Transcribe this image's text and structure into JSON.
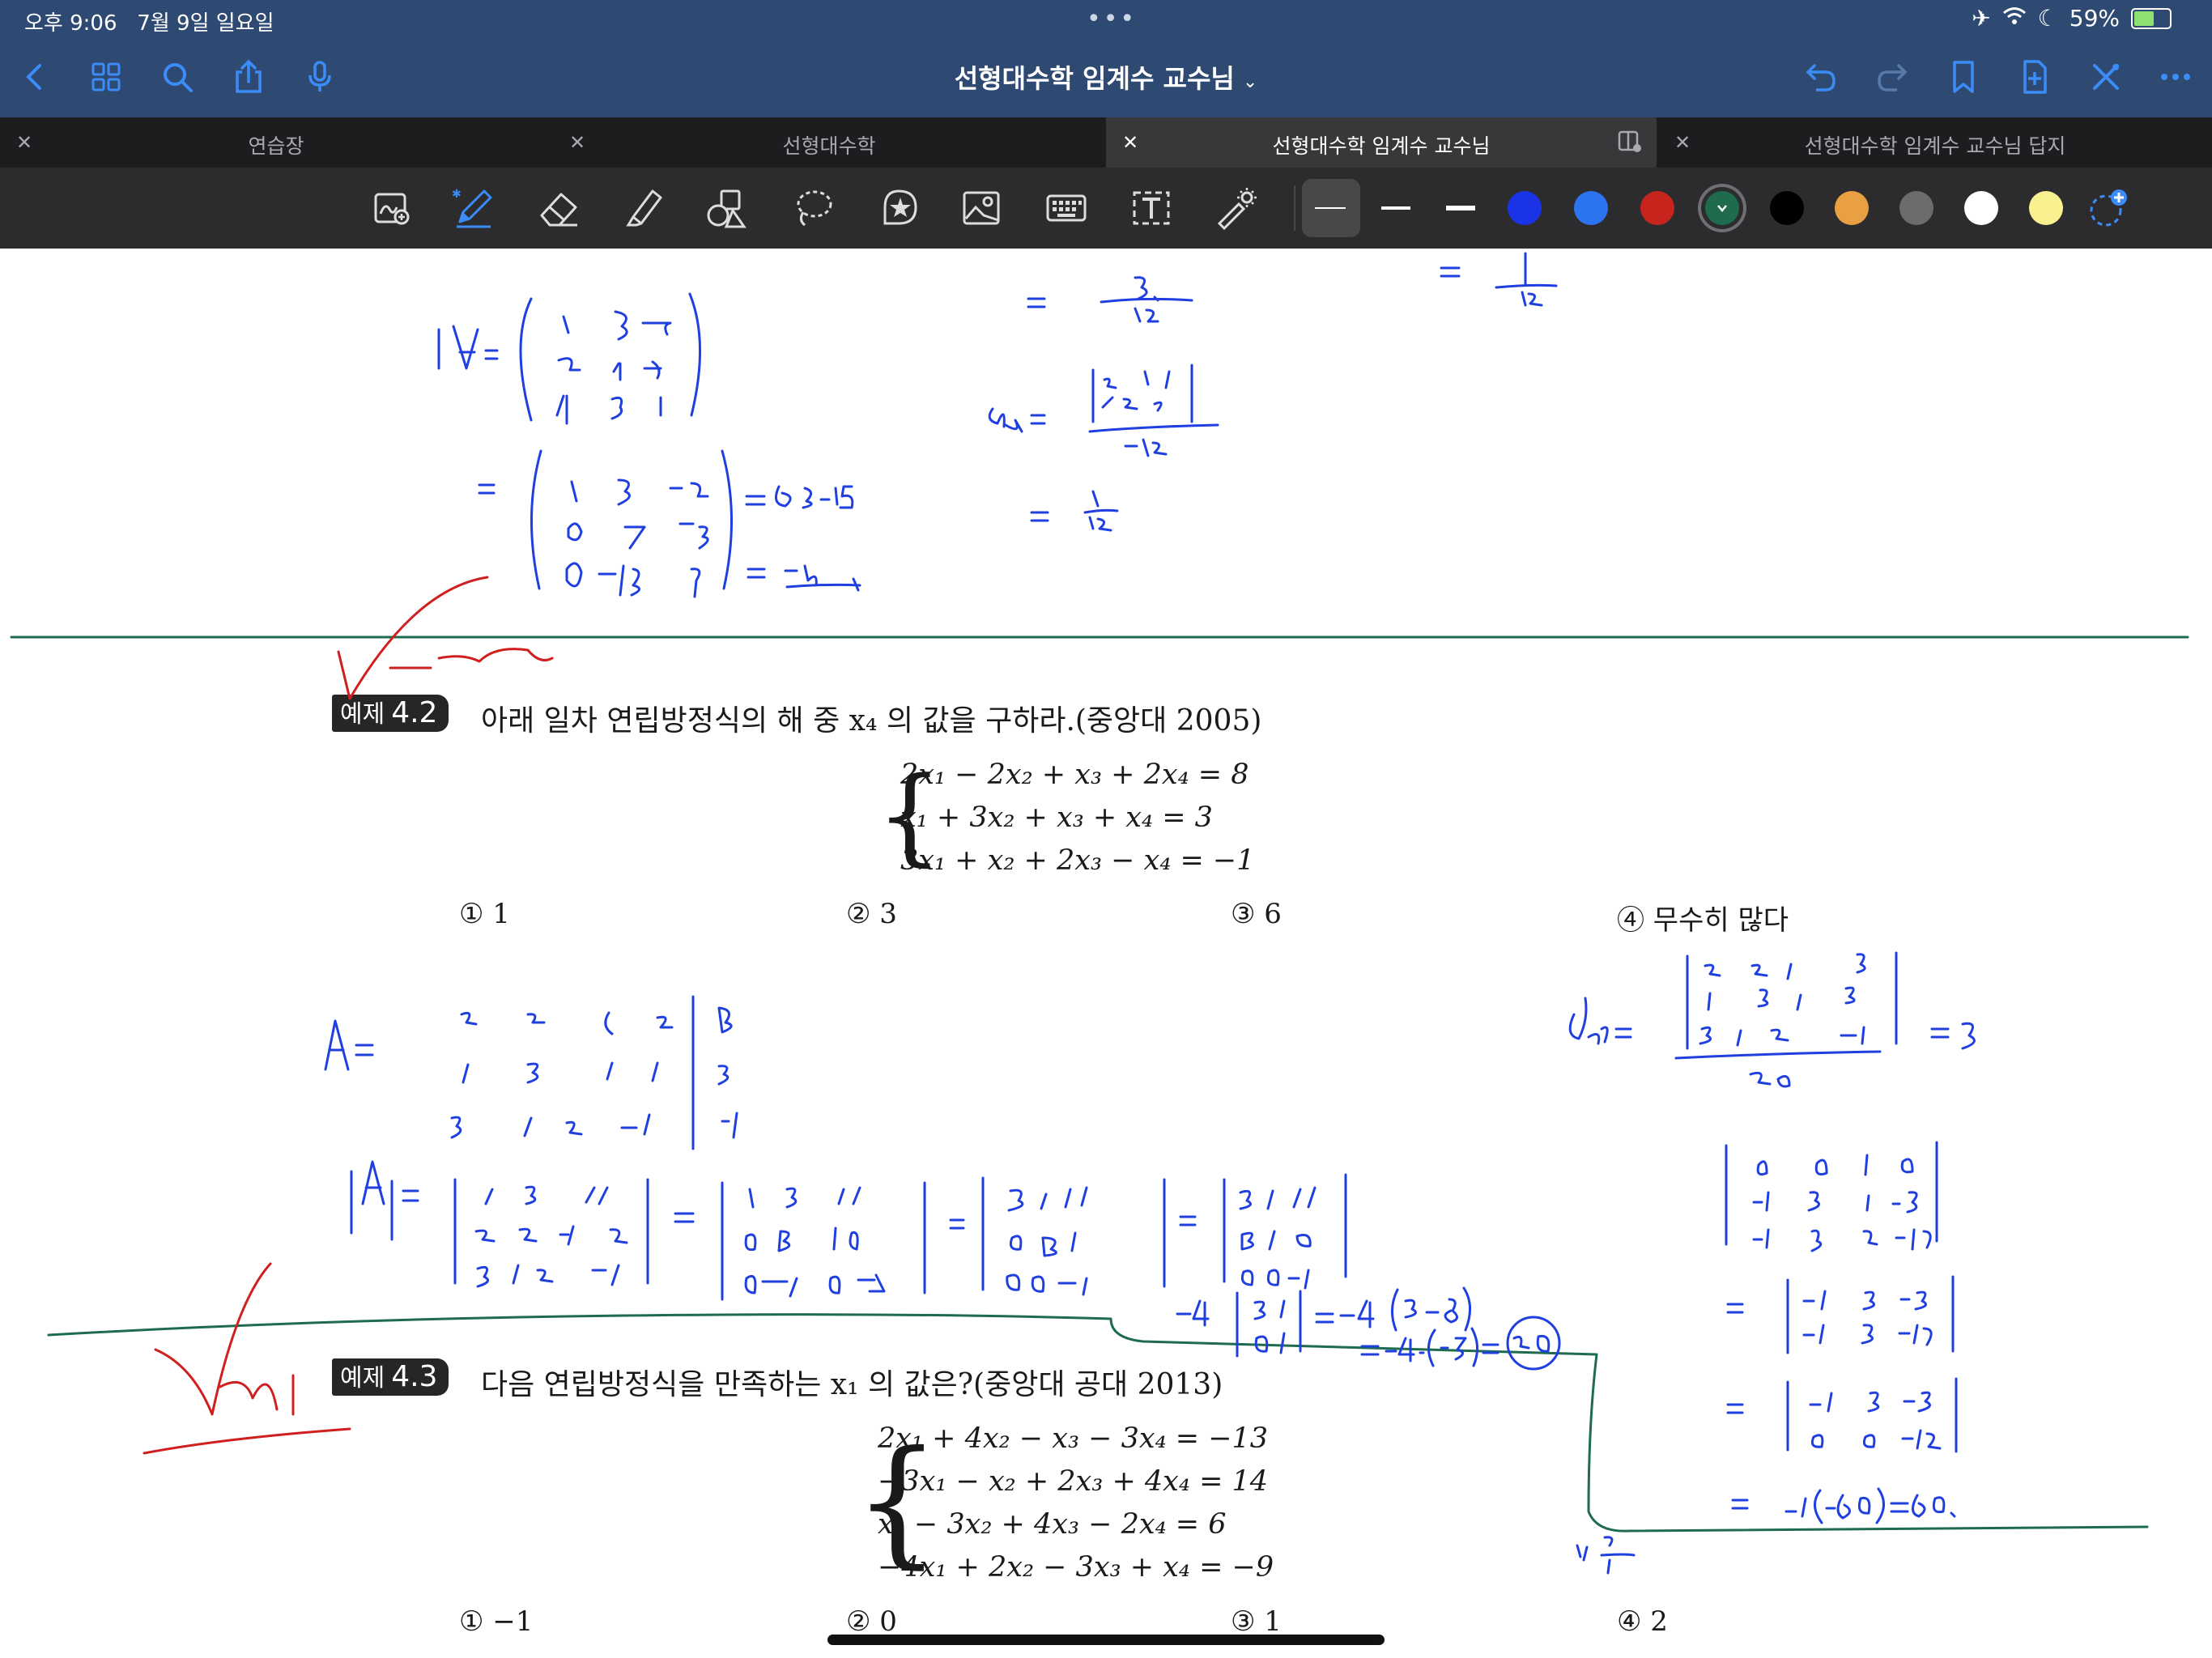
{
  "status_bar": {
    "time": "오후 9:06",
    "date": "7월 9일 일요일",
    "battery": "59%",
    "battery_level": 0.59
  },
  "nav": {
    "title": "선형대수학 임계수 교수님",
    "icons": [
      "back-icon",
      "grid-icon",
      "search-icon",
      "share-icon",
      "microphone-icon",
      "undo-icon",
      "redo-icon",
      "bookmark-icon",
      "add-page-icon",
      "close-x-icon",
      "more-icon"
    ]
  },
  "tabs": [
    {
      "label": "연습장",
      "active": false
    },
    {
      "label": "선형대수학",
      "active": false
    },
    {
      "label": "선형대수학 임계수 교수님",
      "active": true
    },
    {
      "label": "선형대수학 임계수 교수님 답지",
      "active": false
    }
  ],
  "toolbar": {
    "tools": [
      "lasso-search-icon",
      "pen-icon",
      "eraser-icon",
      "highlighter-icon",
      "shapes-icon",
      "lasso-icon",
      "sticker-icon",
      "image-icon",
      "keyboard-icon",
      "text-icon",
      "laser-pointer-icon"
    ],
    "colors": [
      "#1a33e6",
      "#2d74f0",
      "#c8241e",
      "#1e6b4e",
      "#000000",
      "#e9a043",
      "#6c6c6e",
      "#ffffff",
      "#f9f18f"
    ],
    "selected_color": "#1e6b4e"
  },
  "document": {
    "ex42": {
      "badge_label": "예제",
      "badge_num": "4.2",
      "question": "아래 일차 연립방정식의 해 중 x₄ 의 값을 구하라.(중앙대 2005)",
      "equations": [
        "2x₁ − 2x₂ + x₃ + 2x₄ = 8",
        "x₁ + 3x₂ + x₃ + x₄ = 3",
        "3x₁ + x₂ + 2x₃ − x₄ = −1"
      ],
      "choices": [
        "① 1",
        "② 3",
        "③ 6",
        "④ 무수히 많다"
      ]
    },
    "ex43": {
      "badge_label": "예제",
      "badge_num": "4.3",
      "question": "다음 연립방정식을 만족하는 x₁ 의 값은?(중앙대 공대 2013)",
      "equations": [
        "2x₁ + 4x₂ − x₃ − 3x₄ = −13",
        "−3x₁ − x₂ + 2x₃ + 4x₄ = 14",
        "x₁ − 3x₂ + 4x₃ − 2x₄ = 6",
        "−4x₁ + 2x₂ − 3x₃ + x₄ = −9"
      ],
      "choices": [
        "① −1",
        "② 0",
        "③ 1",
        "④ 2"
      ]
    }
  }
}
